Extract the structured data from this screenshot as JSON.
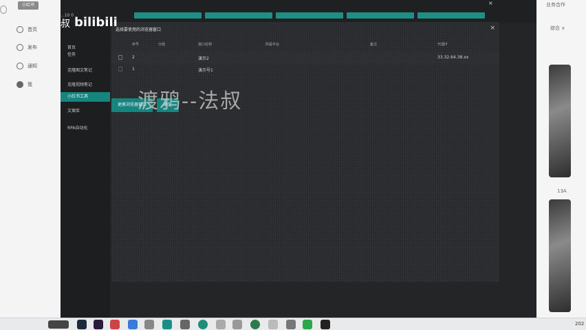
{
  "background_app": {
    "logo_text": "小红书",
    "nav": [
      {
        "label": "首页",
        "icon": "home-icon"
      },
      {
        "label": "发布",
        "icon": "plus-circle-icon"
      },
      {
        "label": "通知",
        "icon": "bell-icon"
      },
      {
        "label": "我",
        "icon": "user-icon"
      }
    ],
    "right_texts": [
      "业务合作",
      "综合 ∨",
      "13A"
    ]
  },
  "window": {
    "top_label": "...10 0",
    "top_buttons": [
      "",
      "",
      "",
      "",
      ""
    ],
    "close_glyph": "×",
    "sidebar": [
      {
        "label": "首页",
        "active": false
      },
      {
        "label": "任务",
        "active": false
      },
      {
        "label": "克隆图文笔记",
        "active": false
      },
      {
        "label": "克隆视频笔记",
        "active": false
      },
      {
        "label": "小红书工具",
        "active": true
      },
      {
        "label": "文案库",
        "active": false
      },
      {
        "label": "RPA自动化",
        "active": false
      }
    ]
  },
  "dialog": {
    "title": "选择要使用的浏览器窗口",
    "close_glyph": "×",
    "columns": [
      "序号",
      "分组",
      "窗口名称",
      "所属平台",
      "备注",
      "代理IP"
    ],
    "rows": [
      {
        "index": "2",
        "group": "",
        "name": "演示2",
        "platform": "",
        "note": "",
        "proxy": "33.32.64.38.xx"
      },
      {
        "index": "1",
        "group": "",
        "name": "演示号1",
        "platform": "",
        "note": "",
        "proxy": ""
      }
    ],
    "buttons": {
      "primary": "更换浏览器窗口",
      "confirm": "确定"
    }
  },
  "overlay": {
    "watermark": "渡鸦--法叔",
    "bilibili_logo": "bilibili",
    "bilibili_prefix": "叔"
  },
  "taskbar": {
    "time": "202"
  },
  "colors": {
    "accent": "#16857d",
    "dark_bg": "#242527",
    "dialog_bg": "#2a2b2d"
  }
}
